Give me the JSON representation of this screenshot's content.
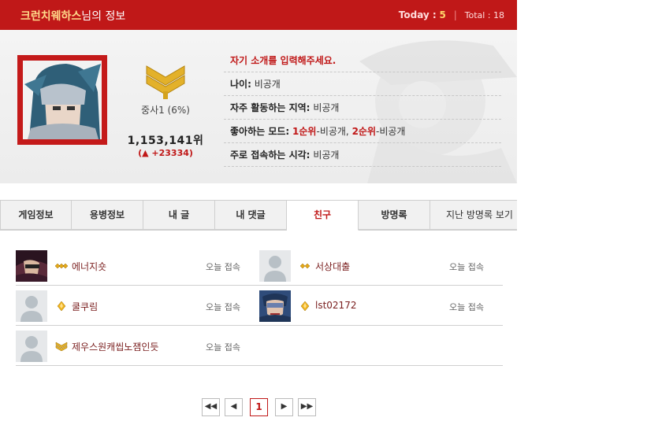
{
  "header": {
    "nickname": "크런치웨하스",
    "title_suffix": "님의 정보",
    "today_label": "Today :",
    "today_value": "5",
    "separator": "|",
    "total_text": "Total : 18"
  },
  "profile": {
    "rank_label": "중사1 (6%)",
    "rank_number": "1,153,141위",
    "rank_change": "(▲ +23334)",
    "intro": "자기 소개를 입력해주세요.",
    "age_label": "나이:",
    "age_value": "비공개",
    "region_label": "자주 활동하는 지역:",
    "region_value": "비공개",
    "mode_label": "좋아하는 모드:",
    "mode_first": "1순위",
    "mode_first_value": "-비공개, ",
    "mode_second": "2순위",
    "mode_second_value": "-비공개",
    "time_label": "주로 접속하는 시각:",
    "time_value": "비공개"
  },
  "tabs": [
    {
      "label": "게임정보",
      "active": false
    },
    {
      "label": "용병정보",
      "active": false
    },
    {
      "label": "내 글",
      "active": false
    },
    {
      "label": "내 댓글",
      "active": false
    },
    {
      "label": "친구",
      "active": true
    },
    {
      "label": "방명록",
      "active": false
    },
    {
      "label": "지난 방명록 보기",
      "active": false
    }
  ],
  "friends": [
    {
      "name": "에너지숏",
      "status": "오늘 접속",
      "rank_icon": "triple-diamond-rank-icon",
      "avatar": "character-avatar"
    },
    {
      "name": "서상대출",
      "status": "오늘 접속",
      "rank_icon": "double-diamond-rank-icon",
      "avatar": "default-avatar"
    },
    {
      "name": "쿨쿠림",
      "status": "오늘 접속",
      "rank_icon": "diamond-rank-icon",
      "avatar": "default-avatar"
    },
    {
      "name": "lst02172",
      "status": "오늘 접속",
      "rank_icon": "diamond-rank-icon",
      "avatar": "character-avatar"
    },
    {
      "name": "제우스원캐씹노잼인듯",
      "status": "오늘 접속",
      "rank_icon": "chevron-rank-icon",
      "avatar": "default-avatar"
    }
  ],
  "pager": {
    "first": "◀◀",
    "prev": "◀",
    "current": "1",
    "next": "▶",
    "last": "▶▶"
  },
  "colors": {
    "accent": "#c01818",
    "nickname": "#ffd98a",
    "friend_name": "#7a1f1f"
  }
}
